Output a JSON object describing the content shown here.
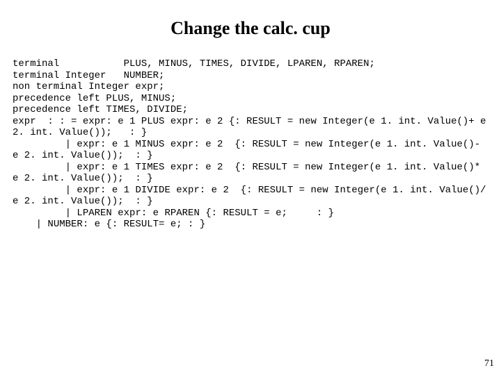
{
  "title": "Change the calc. cup",
  "code_lines": [
    "terminal           PLUS, MINUS, TIMES, DIVIDE, LPAREN, RPAREN;",
    "terminal Integer   NUMBER;",
    "non terminal Integer expr;",
    "precedence left PLUS, MINUS;",
    "precedence left TIMES, DIVIDE;",
    "expr  : : = expr: e 1 PLUS expr: e 2 {: RESULT = new Integer(e 1. int. Value()+ e 2. int. Value());   : }",
    "         | expr: e 1 MINUS expr: e 2  {: RESULT = new Integer(e 1. int. Value()- e 2. int. Value());  : }",
    "         | expr: e 1 TIMES expr: e 2  {: RESULT = new Integer(e 1. int. Value()* e 2. int. Value());  : }",
    "         | expr: e 1 DIVIDE expr: e 2  {: RESULT = new Integer(e 1. int. Value()/ e 2. int. Value());  : }",
    "         | LPAREN expr: e RPAREN {: RESULT = e;     : }",
    "    | NUMBER: e {: RESULT= e; : }"
  ],
  "page_number": "71"
}
